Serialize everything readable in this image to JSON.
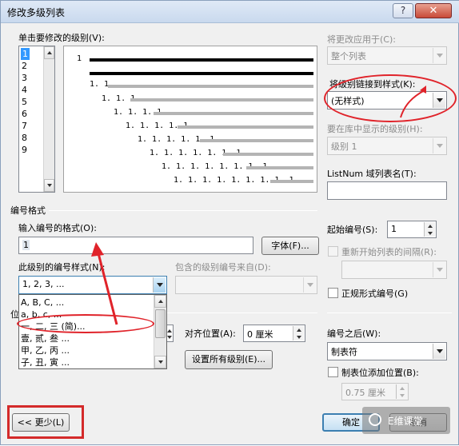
{
  "window": {
    "title": "修改多级列表",
    "help_label": "?",
    "close_label": "✕"
  },
  "level_select": {
    "label": "单击要修改的级别(V):",
    "levels": [
      "1",
      "2",
      "3",
      "4",
      "5",
      "6",
      "7",
      "8",
      "9"
    ],
    "selected": "1"
  },
  "preview": {
    "labels": [
      "1",
      "1. 1",
      "1. 1. 1",
      "1. 1. 1. 1",
      "1. 1. 1. 1. 1",
      "1. 1. 1. 1. 1. 1",
      "1. 1. 1. 1. 1. 1. 1",
      "1. 1. 1. 1. 1. 1. 1. 1",
      "1. 1. 1. 1. 1. 1. 1. 1. 1"
    ]
  },
  "apply_to": {
    "label": "将更改应用于(C):",
    "value": "整个列表"
  },
  "link_style": {
    "label": "将级别链接到样式(K):",
    "value": "(无样式)"
  },
  "gallery_level": {
    "label": "要在库中显示的级别(H):",
    "value": "级别 1"
  },
  "listnum": {
    "label": "ListNum 域列表名(T):",
    "value": ""
  },
  "number_format": {
    "section_title": "编号格式",
    "format_label": "输入编号的格式(O):",
    "format_value": "1",
    "font_button": "字体(F)...",
    "style_label": "此级别的编号样式(N):",
    "style_value": "1, 2, 3, ...",
    "style_options": [
      "A, B, C, ...",
      "a, b, c, ...",
      "一, 二, 三 (简)...",
      "壹, 贰, 叁 ...",
      "甲, 乙, 丙 ...",
      "子, 丑, 寅 ..."
    ],
    "include_from_label": "包含的级别编号来自(D):",
    "include_from_value": "",
    "start_at_label": "起始编号(S):",
    "start_at_value": "1",
    "restart_label": "重新开始列表的间隔(R):",
    "restart_value": "",
    "legal_label": "正规形式编号(G)"
  },
  "position": {
    "partial_label": "位",
    "align_label": "对齐位置(A):",
    "align_value": "0 厘米",
    "set_all_button": "设置所有级别(E)..."
  },
  "follow_number": {
    "label": "编号之后(W):",
    "value": "制表符",
    "tab_stop_label": "制表位添加位置(B):",
    "tab_stop_value": "0.75 厘米"
  },
  "buttons": {
    "less": "<< 更少(L)",
    "ok": "确定",
    "cancel": "取消"
  },
  "watermark": "E维课堂",
  "colors": {
    "annotation_red": "#e0232a",
    "selection_blue": "#3399ff"
  }
}
